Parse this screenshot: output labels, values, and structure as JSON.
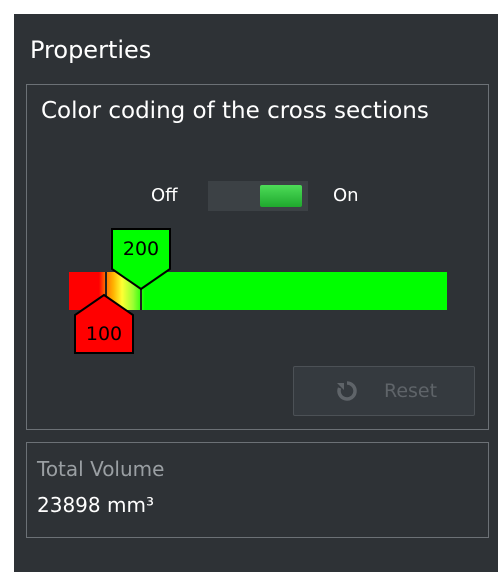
{
  "panel": {
    "title": "Properties"
  },
  "color_coding": {
    "title": "Color coding of the cross sections",
    "toggle": {
      "off_label": "Off",
      "on_label": "On",
      "state": "on"
    },
    "color_bar": {
      "low_color": "#ff0000",
      "high_color": "#00ff00",
      "gradient_colors": [
        "#ff0000",
        "#ff6a00",
        "#ffff33",
        "#00ff00"
      ]
    },
    "upper_marker": {
      "value": "200",
      "color": "#00ff00"
    },
    "lower_marker": {
      "value": "100",
      "color": "#ff0000"
    },
    "reset_button": {
      "label": "Reset",
      "icon": "refresh-icon",
      "enabled": false
    }
  },
  "volume": {
    "label": "Total Volume",
    "value": "23898 mm³"
  },
  "colors": {
    "panel_background": "#2e3236",
    "border": "#6c7176",
    "toggle_on": "#2fc83c"
  }
}
